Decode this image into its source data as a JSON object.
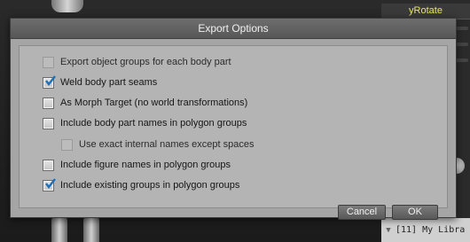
{
  "dialog": {
    "title": "Export Options",
    "options": [
      {
        "label": "Export object groups for each body part",
        "checked": false,
        "disabled": true
      },
      {
        "label": "Weld body part seams",
        "checked": true,
        "disabled": false
      },
      {
        "label": "As Morph Target (no world transformations)",
        "checked": false,
        "disabled": false
      },
      {
        "label": "Include body part names in polygon groups",
        "checked": false,
        "disabled": false
      },
      {
        "label": "Use exact internal names except spaces",
        "checked": false,
        "disabled": true
      },
      {
        "label": "Include figure names in polygon groups",
        "checked": false,
        "disabled": false
      },
      {
        "label": "Include existing groups in polygon groups",
        "checked": true,
        "disabled": false
      }
    ],
    "buttons": {
      "cancel": "Cancel",
      "ok": "OK"
    }
  },
  "background": {
    "parameter_label": "yRotate",
    "library_label": "[11] My Libra",
    "library_arrow": "▼"
  }
}
